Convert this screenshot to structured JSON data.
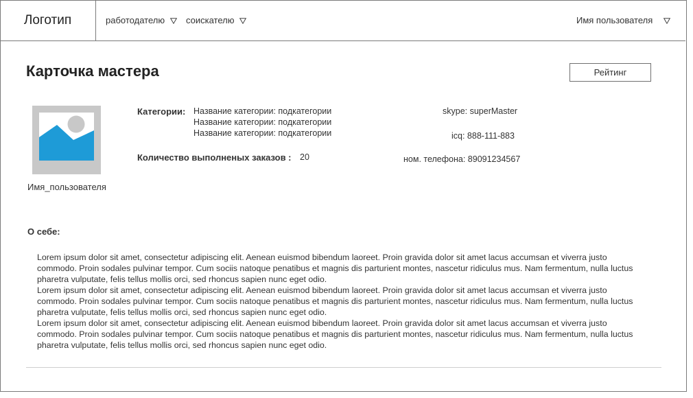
{
  "header": {
    "logo": "Логотип",
    "nav": {
      "employer": "работодателю",
      "seeker": "соискателю"
    },
    "user_menu": "Имя пользователя"
  },
  "main": {
    "title": "Карточка мастера",
    "rating_button": "Рейтинг",
    "avatar_name": "Имя_пользователя",
    "categories_label": "Категории:",
    "categories": [
      "Название категории: подкатегории",
      "Название категории: подкатегории",
      "Название категории: подкатегории"
    ],
    "orders_label": "Количество выполненых заказов :",
    "orders_value": "20",
    "contacts": {
      "skype": "skype: superMaster",
      "icq": "icq: 888-111-883",
      "phone": "ном. телефона: 89091234567"
    },
    "about_label": "О себе:",
    "about_paragraphs": [
      "Lorem ipsum dolor sit amet, consectetur adipiscing elit. Aenean euismod bibendum laoreet. Proin gravida dolor sit amet lacus accumsan et viverra justo commodo. Proin sodales pulvinar tempor. Cum sociis natoque penatibus et magnis dis parturient montes, nascetur ridiculus mus. Nam fermentum, nulla luctus pharetra vulputate, felis tellus mollis orci, sed rhoncus sapien nunc eget odio.",
      "Lorem ipsum dolor sit amet, consectetur adipiscing elit. Aenean euismod bibendum laoreet. Proin gravida dolor sit amet lacus accumsan et viverra justo commodo. Proin sodales pulvinar tempor. Cum sociis natoque penatibus et magnis dis parturient montes, nascetur ridiculus mus. Nam fermentum, nulla luctus pharetra vulputate, felis tellus mollis orci, sed rhoncus sapien nunc eget odio.",
      "Lorem ipsum dolor sit amet, consectetur adipiscing elit. Aenean euismod bibendum laoreet. Proin gravida dolor sit amet lacus accumsan et viverra justo commodo. Proin sodales pulvinar tempor. Cum sociis natoque penatibus et magnis dis parturient montes, nascetur ridiculus mus. Nam fermentum, nulla luctus pharetra vulputate, felis tellus mollis orci, sed rhoncus sapien nunc eget odio."
    ]
  },
  "icons": {
    "dropdown": "triangle-down-icon",
    "avatar": "image-placeholder-icon"
  },
  "colors": {
    "avatar_bg": "#c8c8c8",
    "avatar_mountain": "#1e9bd7",
    "border": "#7a7a7a"
  }
}
